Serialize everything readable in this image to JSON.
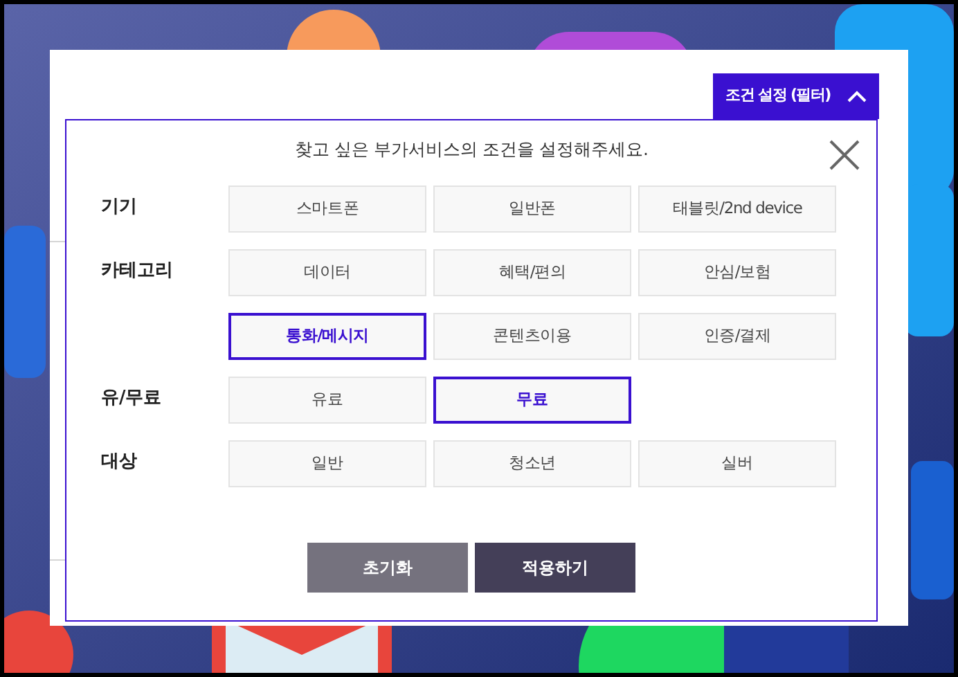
{
  "filter_toggle": {
    "label": "조건 설정 (필터)",
    "expanded": true
  },
  "prompt": "찾고 싶은 부가서비스의 조건을 설정해주세요.",
  "rows": [
    {
      "label": "기기",
      "options": [
        {
          "label": "스마트폰",
          "selected": false
        },
        {
          "label": "일반폰",
          "selected": false
        },
        {
          "label": "태블릿/2nd device",
          "selected": false
        }
      ]
    },
    {
      "label": "카테고리",
      "options": [
        {
          "label": "데이터",
          "selected": false
        },
        {
          "label": "혜택/편의",
          "selected": false
        },
        {
          "label": "안심/보험",
          "selected": false
        },
        {
          "label": "통화/메시지",
          "selected": true
        },
        {
          "label": "콘텐츠이용",
          "selected": false
        },
        {
          "label": "인증/결제",
          "selected": false
        }
      ]
    },
    {
      "label": "유/무료",
      "options": [
        {
          "label": "유료",
          "selected": false
        },
        {
          "label": "무료",
          "selected": true
        }
      ]
    },
    {
      "label": "대상",
      "options": [
        {
          "label": "일반",
          "selected": false
        },
        {
          "label": "청소년",
          "selected": false
        },
        {
          "label": "실버",
          "selected": false
        }
      ]
    }
  ],
  "buttons": [
    {
      "label": "초기화",
      "kind": "reset"
    },
    {
      "label": "적용하기",
      "kind": "apply"
    }
  ]
}
